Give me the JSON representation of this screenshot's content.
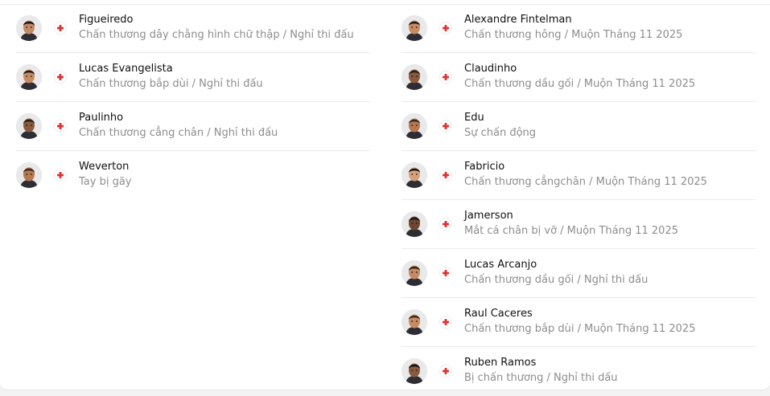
{
  "colors": {
    "injury_cross": "#e03131",
    "name_text": "#111111",
    "status_text": "#8d8d8d"
  },
  "left_column": [
    {
      "name": "Figueiredo",
      "status": "Chấn thương dây chằng hình chữ thập / Nghỉ thi đấu",
      "icon": "injury-cross-icon"
    },
    {
      "name": "Lucas Evangelista",
      "status": "Chấn thương bắp dùi / Nghỉ thi đấu",
      "icon": "injury-cross-icon"
    },
    {
      "name": "Paulinho",
      "status": "Chấn thương cẳng chân / Nghỉ thi đấu",
      "icon": "injury-cross-icon"
    },
    {
      "name": "Weverton",
      "status": "Tay bị gãy",
      "icon": "injury-cross-icon"
    }
  ],
  "right_column": [
    {
      "name": "Alexandre Fintelman",
      "status": "Chấn thương hông / Muộn Tháng 11 2025",
      "icon": "injury-cross-icon"
    },
    {
      "name": "Claudinho",
      "status": "Chấn thương dầu gối / Muộn Tháng 11 2025",
      "icon": "injury-cross-icon"
    },
    {
      "name": "Edu",
      "status": "Sự chấn động",
      "icon": "injury-cross-icon"
    },
    {
      "name": "Fabricio",
      "status": "Chấn thương cẳngchân / Muộn Tháng 11 2025",
      "icon": "injury-cross-icon"
    },
    {
      "name": "Jamerson",
      "status": "Mắt cá chân bị vỡ / Muộn Tháng 11 2025",
      "icon": "injury-cross-icon"
    },
    {
      "name": "Lucas Arcanjo",
      "status": "Chấn thương dầu gối / Nghỉ thi dấu",
      "icon": "injury-cross-icon"
    },
    {
      "name": "Raul Caceres",
      "status": "Chấn thương bắp dùi / Muộn Tháng 11 2025",
      "icon": "injury-cross-icon"
    },
    {
      "name": "Ruben Ramos",
      "status": "Bị chấn thương / Nghỉ thi dấu",
      "icon": "injury-cross-icon"
    }
  ]
}
